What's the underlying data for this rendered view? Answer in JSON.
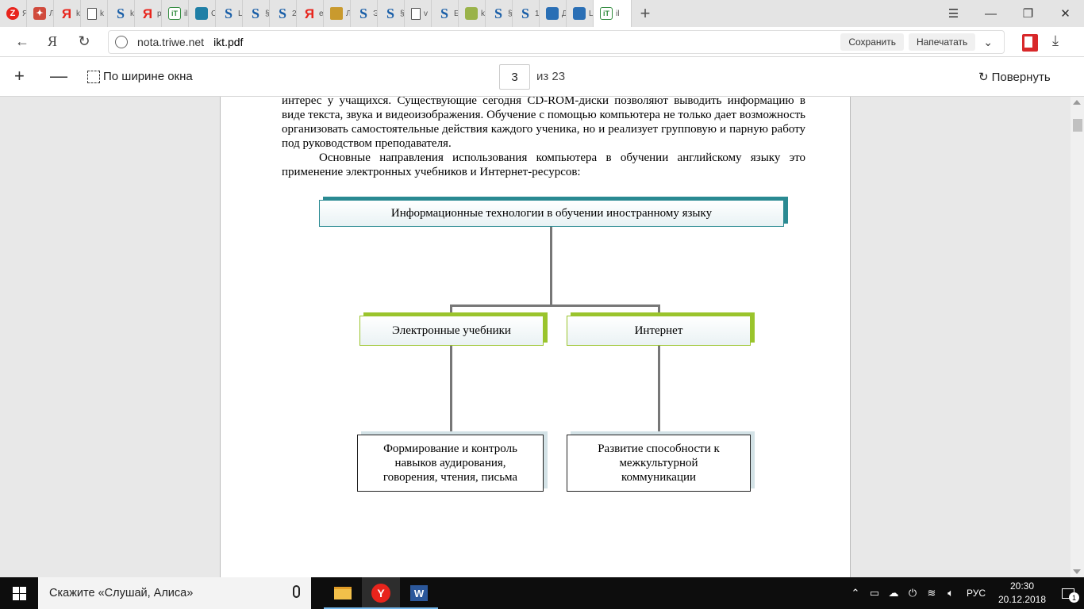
{
  "tabs": [
    {
      "icon": "yandex-z-icon",
      "glyph": "Z",
      "cls": "z",
      "label": "Я"
    },
    {
      "icon": "abstract-icon",
      "glyph": "✦",
      "cls": "ab",
      "label": "Л"
    },
    {
      "icon": "yandex-icon",
      "glyph": "Я",
      "cls": "ya",
      "label": "k"
    },
    {
      "icon": "document-icon",
      "glyph": "",
      "cls": "doc",
      "label": "k"
    },
    {
      "icon": "s-site-icon",
      "glyph": "S",
      "cls": "s",
      "label": "k"
    },
    {
      "icon": "yandex-icon",
      "glyph": "Я",
      "cls": "ya",
      "label": "р"
    },
    {
      "icon": "it-site-icon",
      "glyph": "iT",
      "cls": "it",
      "label": "il"
    },
    {
      "icon": "book-icon",
      "glyph": "",
      "cls": "book",
      "label": "С"
    },
    {
      "icon": "s-site-icon",
      "glyph": "S",
      "cls": "s",
      "label": "L"
    },
    {
      "icon": "s-site-icon",
      "glyph": "S",
      "cls": "s",
      "label": "§"
    },
    {
      "icon": "s-site-icon",
      "glyph": "S",
      "cls": "s",
      "label": "2"
    },
    {
      "icon": "yandex-icon",
      "glyph": "Я",
      "cls": "ya",
      "label": "е"
    },
    {
      "icon": "graduation-cap-icon",
      "glyph": "",
      "cls": "cap",
      "label": "Л"
    },
    {
      "icon": "s-site-icon",
      "glyph": "S",
      "cls": "s",
      "label": "Э"
    },
    {
      "icon": "s-site-icon",
      "glyph": "S",
      "cls": "s",
      "label": "§"
    },
    {
      "icon": "document-icon",
      "glyph": "",
      "cls": "doc",
      "label": "v"
    },
    {
      "icon": "s-site-icon",
      "glyph": "S",
      "cls": "s",
      "label": "E"
    },
    {
      "icon": "homestead-icon",
      "glyph": "",
      "cls": "hs",
      "label": "k"
    },
    {
      "icon": "s-site-icon",
      "glyph": "S",
      "cls": "s",
      "label": "§"
    },
    {
      "icon": "s-site-icon",
      "glyph": "S",
      "cls": "s",
      "label": "1"
    },
    {
      "icon": "chat-icon",
      "glyph": "",
      "cls": "msg",
      "label": "Д"
    },
    {
      "icon": "chat-icon",
      "glyph": "",
      "cls": "msg",
      "label": "L"
    },
    {
      "icon": "it-site-icon",
      "glyph": "iT",
      "cls": "it",
      "label": "il",
      "active": true
    }
  ],
  "address": {
    "host": "nota.triwe.net",
    "path": "ikt.pdf",
    "save_label": "Сохранить",
    "print_label": "Напечатать"
  },
  "toolbar": {
    "fit_width_label": "По ширине окна",
    "page_current": "3",
    "page_total": "из 23",
    "rotate_label": "Повернуть"
  },
  "document": {
    "paragraph1": "интерес у учащихся. Существующие сегодня CD-ROM-диски позволяют выводить информацию в виде текста, звука и видеоизображения. Обучение с помощью компьютера не только дает возможность организовать самостоятельные действия каждого ученика, но и реализует групповую и парную работу под руководством преподавателя.",
    "paragraph2": "Основные направления использования компьютера в обучении английскому языку это применение электронных учебников и Интернет-ресурсов:"
  },
  "diagram": {
    "root": "Информационные технологии в обучении иностранному языку",
    "left_branch": "Электронные учебники",
    "right_branch": "Интернет",
    "left_leaf": "Формирование  и контроль навыков аудирования, говорения, чтения, письма",
    "right_leaf": "Развитие способности к межкультурной коммуникации"
  },
  "taskbar": {
    "search_placeholder": "Скажите «Слушай, Алиса»",
    "lang": "РУС",
    "time": "20:30",
    "date": "20.12.2018",
    "notifications": "1"
  }
}
